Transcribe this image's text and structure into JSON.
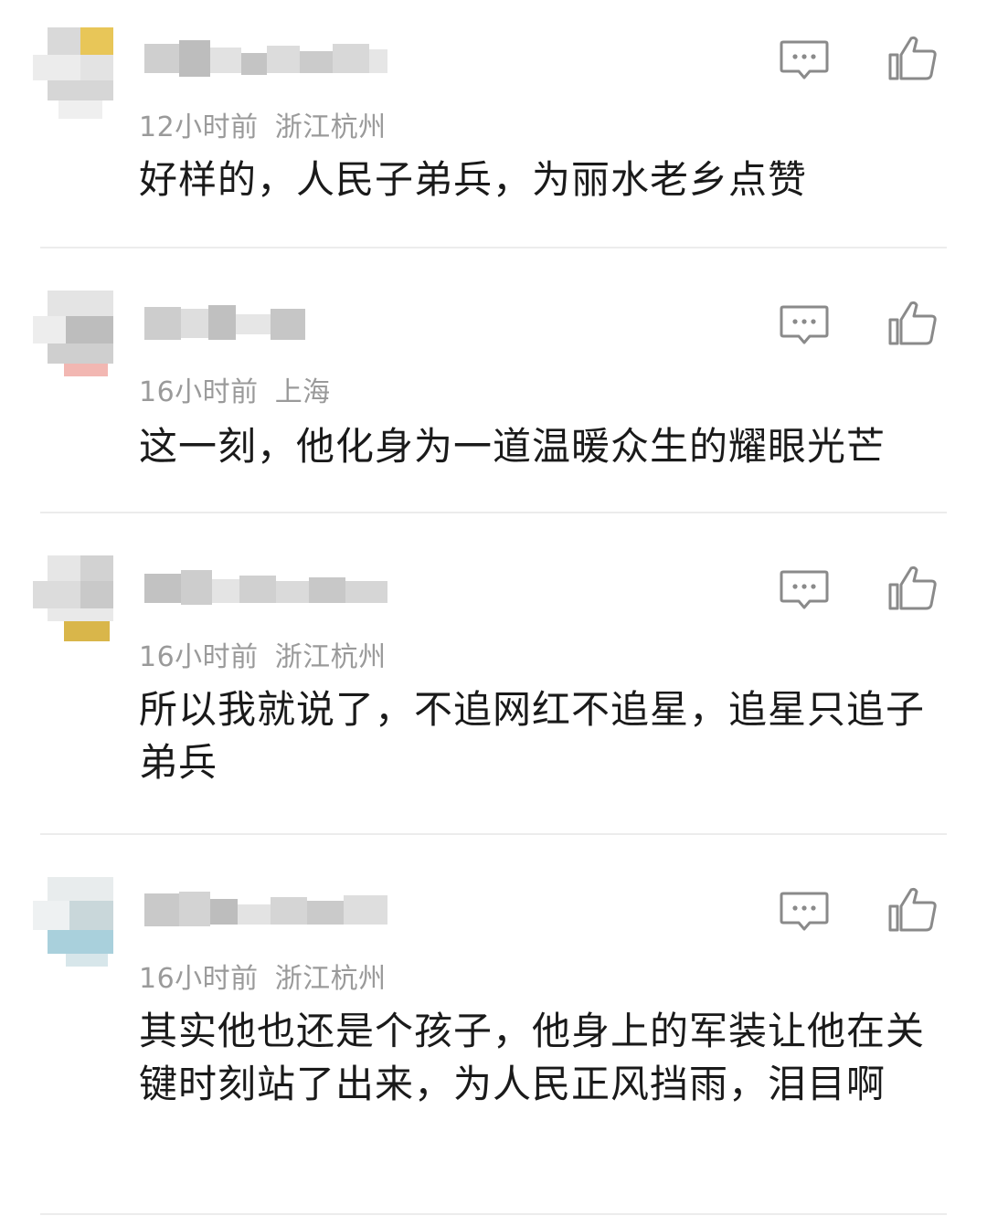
{
  "comments": [
    {
      "time": "12小时前",
      "location": "浙江杭州",
      "text": "好样的，人民子弟兵，为丽水老乡点赞",
      "reply_icon": "comment-bubble-icon",
      "like_icon": "thumbs-up-icon"
    },
    {
      "time": "16小时前",
      "location": "上海",
      "text": "这一刻，他化身为一道温暖众生的耀眼光芒",
      "reply_icon": "comment-bubble-icon",
      "like_icon": "thumbs-up-icon"
    },
    {
      "time": "16小时前",
      "location": "浙江杭州",
      "text": "所以我就说了，不追网红不追星，追星只追子弟兵",
      "reply_icon": "comment-bubble-icon",
      "like_icon": "thumbs-up-icon"
    },
    {
      "time": "16小时前",
      "location": "浙江杭州",
      "text": "其实他也还是个孩子，他身上的军装让他在关键时刻站了出来，为人民正风挡雨，泪目啊",
      "reply_icon": "comment-bubble-icon",
      "like_icon": "thumbs-up-icon"
    }
  ],
  "colors": {
    "meta_text": "#9a9a9a",
    "body_text": "#1a1a1a",
    "icon_stroke": "#8a8a8a",
    "divider": "#ececec"
  }
}
